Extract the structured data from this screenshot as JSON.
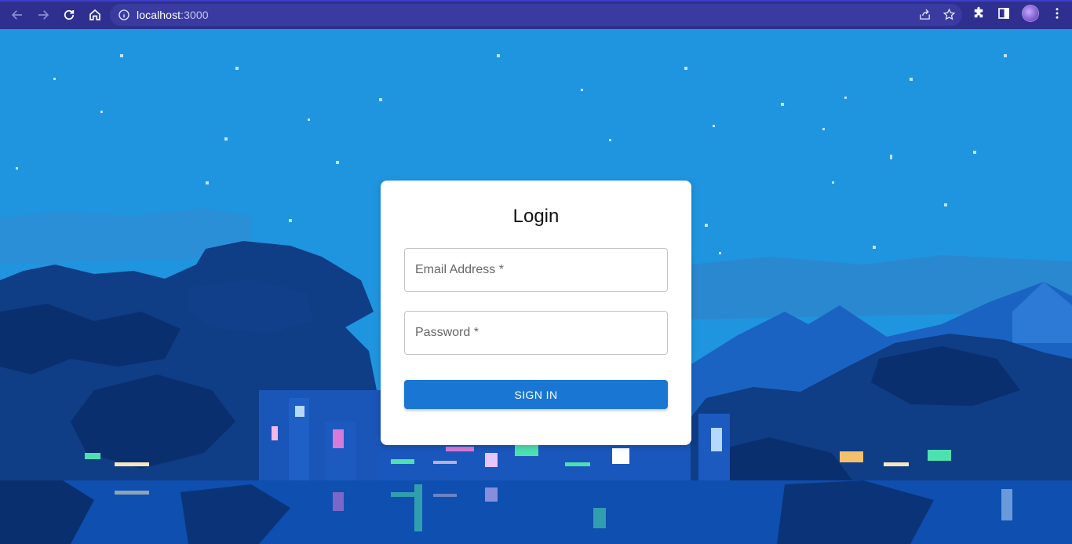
{
  "browser": {
    "url_host": "localhost",
    "url_port": ":3000"
  },
  "login": {
    "title": "Login",
    "email_label": "Email Address *",
    "password_label": "Password *",
    "submit_label": "SIGN IN"
  },
  "colors": {
    "toolbar": "#2e2f8f",
    "sky": "#1f95e0",
    "button": "#1976d2",
    "card": "#ffffff"
  }
}
